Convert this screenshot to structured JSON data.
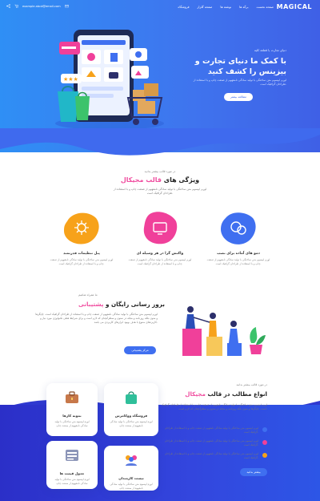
{
  "header": {
    "logo": "MAGICAL",
    "email": "example.abcd@email.com",
    "nav": [
      "صفحه نخست",
      "برگه ها",
      "نوشته ها",
      "صفحه گلزار",
      "فروشگاه"
    ]
  },
  "hero": {
    "kicker": "دنیای تجارت با قطعه کلیه",
    "title": "با کمک ما دنیای تجارت و بیزینس را کشف کنید",
    "description": "لورم ایپسوم متن ساختگی با تولید سادگی نامفهوم از صنعت چاپ و با استفاده از طراحان گرافیک است.",
    "button": "مطالعه بیشتر"
  },
  "features": {
    "kicker": "در مورد قالب بیشتر بدانید",
    "title_main": "ویژگی های",
    "title_accent": "قالب مجیکال",
    "description": "لورم ایپسوم متن ساختگی با تولید سادگی نامفهوم از صنعت چاپ و با استفاده از طراحان گرافیک است.",
    "items": [
      {
        "title": "دمو های آماده برای نصب",
        "desc": "لورم ایپسوم متن ساختگی با تولید سادگی نامفهوم از صنعت چاپ و با استفاده از طراحان گرافیک است.",
        "color": "#3f6ff0",
        "icon": "chat-bubbles-icon"
      },
      {
        "title": "واکنش گرا در هر وسیله ای",
        "desc": "لورم ایپسوم متن ساختگی با تولید سادگی نامفهوم از صنعت چاپ و با استفاده از طراحان گرافیک است.",
        "color": "#f0409a",
        "icon": "monitor-icon"
      },
      {
        "title": "پنل تنظیمات قدرتمند",
        "desc": "لورم ایپسوم متن ساختگی با تولید سادگی نامفهوم از صنعت چاپ و با استفاده از طراحان گرافیک است.",
        "color": "#f7a21a",
        "icon": "gear-icon"
      }
    ]
  },
  "support": {
    "kicker": "ما همراه شاهیم",
    "title_main": "بروز رسانی رایگان و",
    "title_accent": "پشتیبانی",
    "description": "لورم ایپسوم متن ساختگی با تولید سادگی نامفهوم از صنعت چاپ و با استفاده از طراحان گرافیک است. چاپگرها و متون بلکه روزنامه و مجله در ستون و سطرآنچنان که لازم است و برای شرایط فعلی تکنولوژی مورد نیاز و کاربردهای متنوع با هدف بهبود ابزارهای کاربردی می باشد.",
    "button": "مرکز پشتیبانی"
  },
  "modules": {
    "kicker": "در مورد قالب بیشتر بدانید",
    "title_main": "انواع مطالب در قالب",
    "title_accent": "مجیکال",
    "description": "لورم ایپسوم متن ساختگی با تولید سادگی نامفهوم از صنعت چاپ و با استفاده از طراحان گرافیک است. چاپگرها و متون بلکه روزنامه و مجله در ستون و سطرآنچنان که لازم است.",
    "list": [
      {
        "text": "لورم ایپسوم متن ساختگی با تولید سادگی نامفهوم از صنعت چاپ و با استفاده از طراحان گرافیک است.",
        "color": "#3f6ff0"
      },
      {
        "text": "لورم ایپسوم متن ساختگی با تولید سادگی نامفهوم از صنعت چاپ و با استفاده از طراحان گرافیک است.",
        "color": "#f0409a"
      },
      {
        "text": "لورم ایپسوم متن ساختگی با تولید سادگی نامفهوم از صنعت چاپ و با استفاده از طراحان گرافیک است.",
        "color": "#f7a21a"
      }
    ],
    "button": "بیشتر بدانید",
    "cards": [
      {
        "title": "نمونه کارها",
        "desc": "لورم ایپسوم متن ساختگی با تولید سادگی نامفهوم از صنعت چاپ",
        "icon": "briefcase-icon"
      },
      {
        "title": "فروشگاه ووکامرس",
        "desc": "لورم ایپسوم متن ساختگی با تولید سادگی نامفهوم از صنعت چاپ",
        "icon": "shopping-bag-icon"
      },
      {
        "title": "جدول قیمت ها",
        "desc": "لورم ایپسوم متن ساختگی با تولید سادگی نامفهوم از صنعت چاپ",
        "icon": "price-table-icon"
      },
      {
        "title": "تیست کارمندان",
        "desc": "لورم ایپسوم متن ساختگی با تولید سادگی نامفهوم از صنعت چاپ",
        "icon": "team-icon"
      }
    ]
  }
}
